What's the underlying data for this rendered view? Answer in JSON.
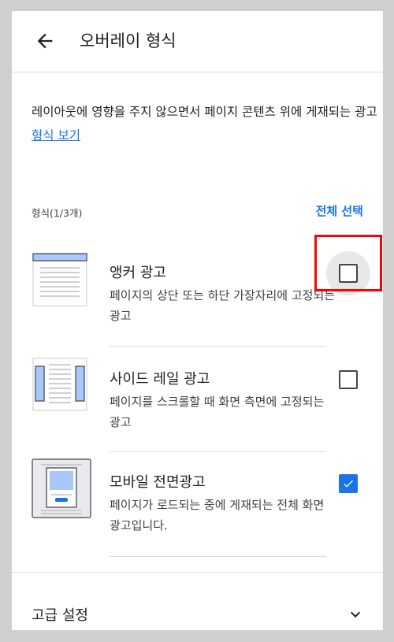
{
  "header": {
    "title": "오버레이 형식",
    "back_icon": "arrow-back-icon"
  },
  "description": {
    "text": "레이아웃에 영향을 주지 않으면서 페이지 콘텐츠 위에 게재되는 광고 ",
    "link_label": "형식 보기"
  },
  "formats": {
    "count_label": "형식(1/3개)",
    "select_all_label": "전체 선택",
    "items": [
      {
        "title": "앵커 광고",
        "description": "페이지의 상단 또는 하단 가장자리에 고정되는 광고",
        "checked": false,
        "icon": "anchor-ad-thumbnail"
      },
      {
        "title": "사이드 레일 광고",
        "description": "페이지를 스크롤할 때 화면 측면에 고정되는 광고",
        "checked": false,
        "icon": "side-rail-ad-thumbnail"
      },
      {
        "title": "모바일 전면광고",
        "description": "페이지가 로드되는 중에 게재되는 전체 화면 광고입니다.",
        "checked": true,
        "icon": "mobile-interstitial-thumbnail"
      }
    ]
  },
  "advanced": {
    "label": "고급 설정",
    "icon": "chevron-down-icon"
  },
  "colors": {
    "accent": "#1a73e8",
    "highlight": "#ff0000"
  }
}
